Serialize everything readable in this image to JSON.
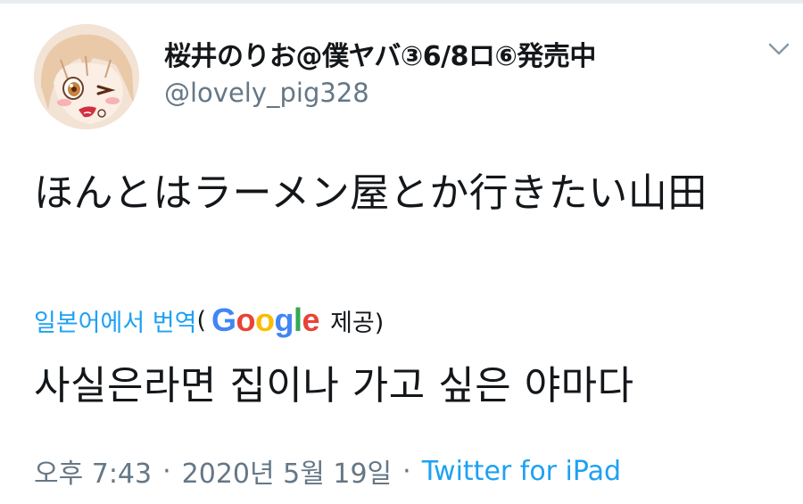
{
  "tweet": {
    "display_name": "桜井のりお@僕ヤバ③6/8ロ⑥発売中",
    "handle": "@lovely_pig328",
    "text": "ほんとはラーメン屋とか行きたい山田",
    "avatar_icon": "anime-girl-winking-avatar",
    "menu_icon": "chevron-down-icon"
  },
  "translation": {
    "link_label": "일본어에서 번역",
    "open_paren": "(",
    "provider": "Google",
    "provided_label": "제공)",
    "text": "사실은라면 집이나 가고 싶은 야마다"
  },
  "meta": {
    "time": "오후 7:43",
    "separator1": "·",
    "date": "2020년 5월 19일",
    "separator2": "·",
    "source": "Twitter for iPad"
  },
  "colors": {
    "link_blue": "#1da1f2",
    "secondary_gray": "#657786",
    "google_blue": "#4285f4",
    "google_red": "#ea4335",
    "google_yellow": "#fbbc05",
    "google_green": "#34a853"
  }
}
